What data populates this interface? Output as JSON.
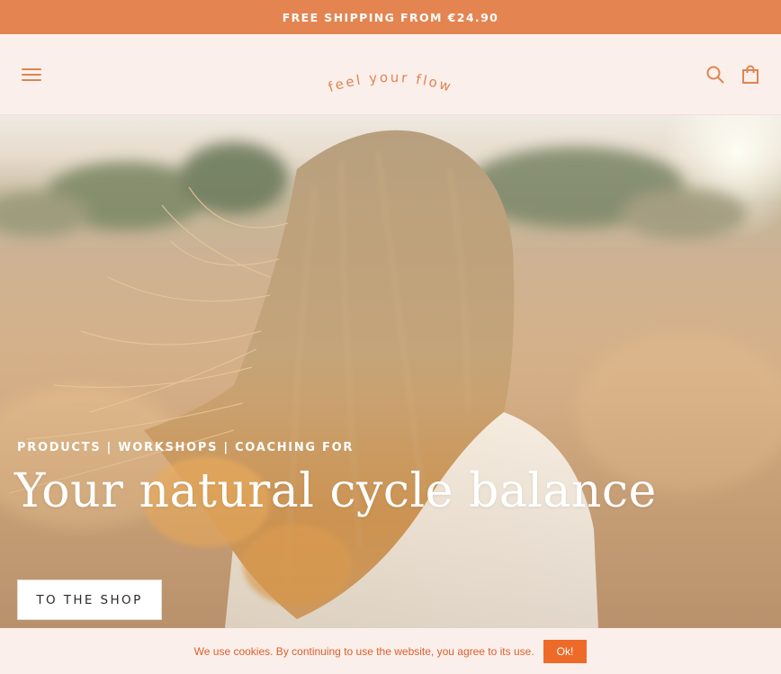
{
  "announcement": {
    "text": "FREE SHIPPING FROM €24.90"
  },
  "header": {
    "logo_text": "feel your flow",
    "menu_icon": "hamburger-icon",
    "search_icon": "search-icon",
    "cart_icon": "shopping-bag-icon"
  },
  "hero": {
    "eyebrow": "PRODUCTS | WORKSHOPS | COACHING FOR",
    "headline": "Your natural cycle balance",
    "cta_label": "TO THE SHOP"
  },
  "cookie_banner": {
    "text": "We use cookies. By continuing to use the website, you agree to its use.",
    "ok_label": "Ok!"
  },
  "colors": {
    "accent": "#e38451",
    "background": "#fbefec",
    "cookie_button": "#ee6a29",
    "cookie_text": "#d9602b"
  }
}
